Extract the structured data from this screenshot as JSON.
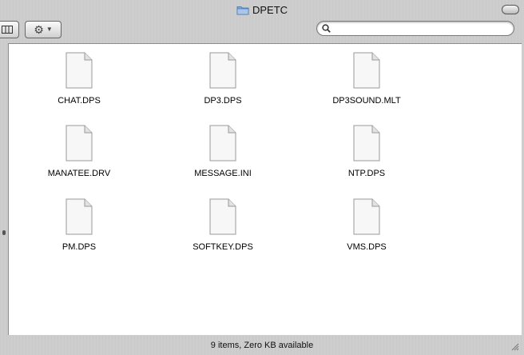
{
  "window": {
    "title": "DPETC"
  },
  "toolbar": {
    "search_placeholder": ""
  },
  "files": [
    {
      "name": "CHAT.DPS"
    },
    {
      "name": "DP3.DPS"
    },
    {
      "name": "DP3SOUND.MLT"
    },
    {
      "name": "MANATEE.DRV"
    },
    {
      "name": "MESSAGE.INI"
    },
    {
      "name": "NTP.DPS"
    },
    {
      "name": "PM.DPS"
    },
    {
      "name": "SOFTKEY.DPS"
    },
    {
      "name": "VMS.DPS"
    }
  ],
  "status": {
    "text": "9 items, Zero KB available"
  },
  "icons": {
    "title_folder": "folder-icon",
    "view": "column-view-icon",
    "action": "gear-icon",
    "search": "magnifier-icon",
    "file": "document-icon"
  }
}
